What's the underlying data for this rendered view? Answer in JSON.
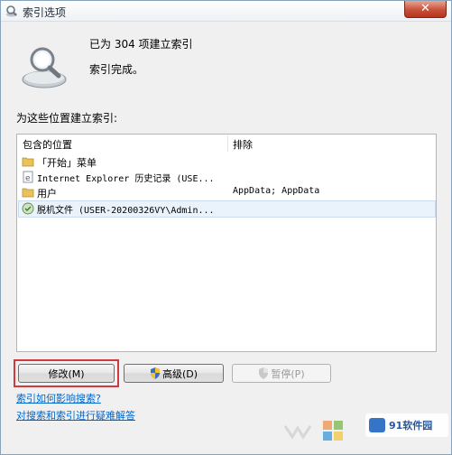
{
  "window": {
    "title": "索引选项",
    "close_glyph": "✕"
  },
  "status": {
    "line1": "已为 304 项建立索引",
    "line2": "索引完成。"
  },
  "locations_label": "为这些位置建立索引:",
  "table": {
    "columns": [
      "包含的位置",
      "排除"
    ],
    "rows": [
      {
        "name": "「开始」菜单",
        "excluded": "",
        "icon": "folder-icon"
      },
      {
        "name": "Internet Explorer 历史记录 (USE...",
        "excluded": "",
        "icon": "ie-history-icon"
      },
      {
        "name": "用户",
        "excluded": "AppData; AppData",
        "icon": "folder-icon"
      },
      {
        "name": "脱机文件 (USER-20200326VY\\Admin...",
        "excluded": "",
        "icon": "offline-files-icon"
      }
    ]
  },
  "buttons": {
    "modify": "修改(M)",
    "advanced": "高级(D)",
    "pause": "暂停(P)"
  },
  "links": {
    "how_indexing": "索引如何影响搜索?",
    "troubleshoot": "对搜索和索引进行疑难解答"
  },
  "watermark": {
    "site": "91软件园"
  },
  "colors": {
    "link": "#0066cc",
    "highlight": "#d2383f",
    "close": "#c8513a"
  }
}
